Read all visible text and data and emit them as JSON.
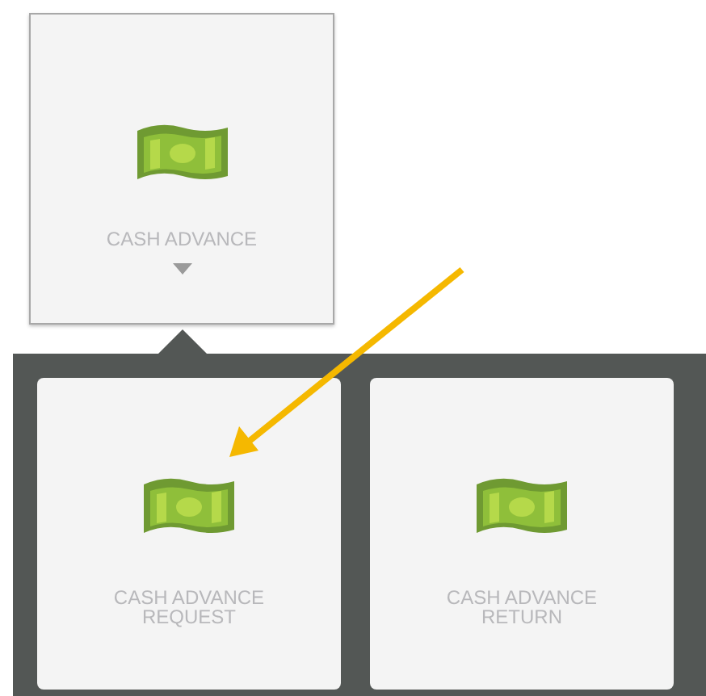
{
  "tile": {
    "label": "CASH ADVANCE",
    "expanded": true
  },
  "submenu": [
    {
      "label": "CASH ADVANCE REQUEST"
    },
    {
      "label": "CASH ADVANCE RETURN"
    }
  ],
  "annotation": {
    "kind": "arrow"
  }
}
